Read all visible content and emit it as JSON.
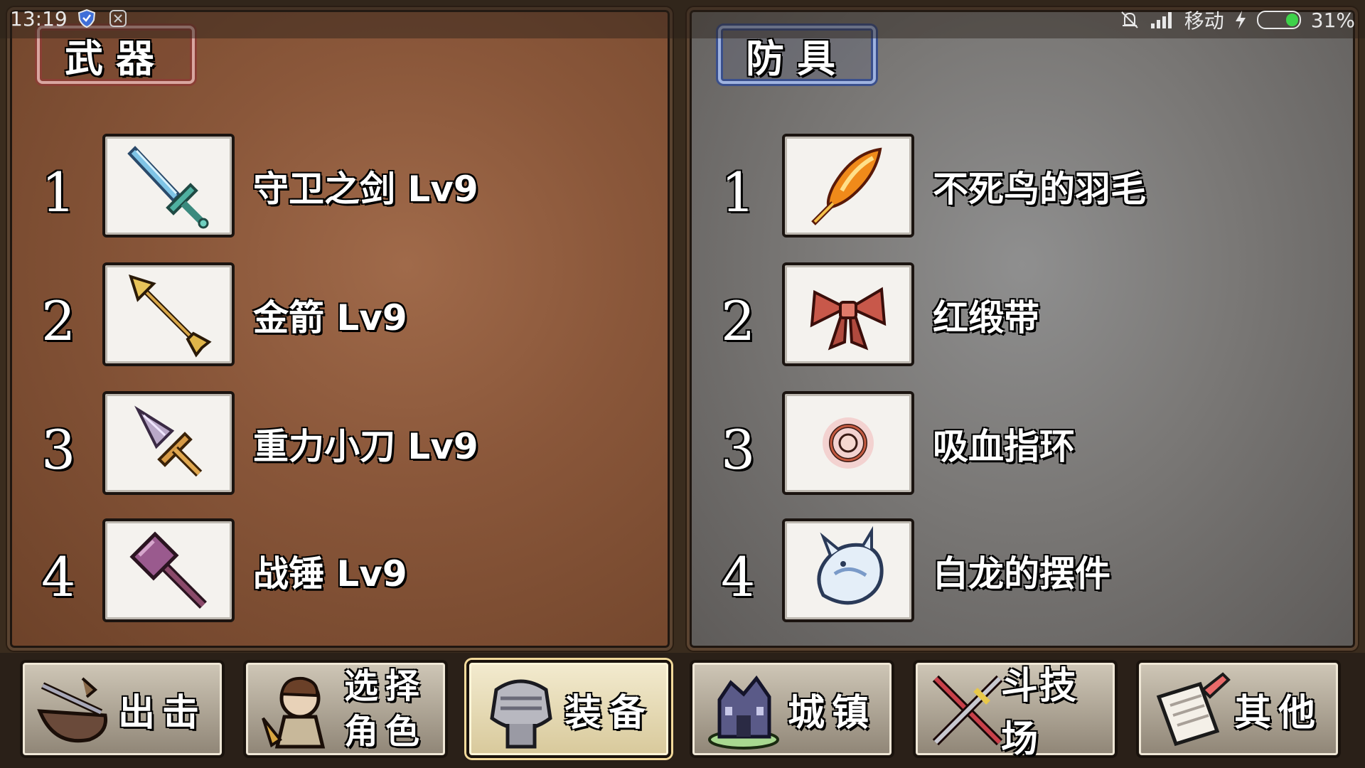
{
  "status_bar": {
    "time": "13:19",
    "carrier": "移动",
    "battery": "31%",
    "battery_level": 0.31
  },
  "weapons": {
    "title": "武器",
    "items": [
      {
        "index": "1",
        "name": "守卫之剑 Lv9",
        "icon": "sword-icon"
      },
      {
        "index": "2",
        "name": "金箭 Lv9",
        "icon": "arrow-icon"
      },
      {
        "index": "3",
        "name": "重力小刀 Lv9",
        "icon": "dagger-icon"
      },
      {
        "index": "4",
        "name": "战锤 Lv9",
        "icon": "hammer-icon"
      }
    ]
  },
  "armor": {
    "title": "防具",
    "items": [
      {
        "index": "1",
        "name": "不死鸟的羽毛",
        "icon": "phoenix-feather-icon"
      },
      {
        "index": "2",
        "name": "红缎带",
        "icon": "red-ribbon-icon"
      },
      {
        "index": "3",
        "name": "吸血指环",
        "icon": "ring-icon"
      },
      {
        "index": "4",
        "name": "白龙的摆件",
        "icon": "white-dragon-icon"
      }
    ]
  },
  "nav": {
    "items": [
      {
        "label": "出击",
        "icon": "sortie-icon"
      },
      {
        "label_line1": "选择",
        "label_line2": "角色",
        "icon": "character-icon"
      },
      {
        "label": "装备",
        "icon": "armor-icon",
        "active": true
      },
      {
        "label": "城镇",
        "icon": "town-icon"
      },
      {
        "label": "斗技场",
        "icon": "arena-icon"
      },
      {
        "label": "其他",
        "icon": "other-icon"
      }
    ]
  },
  "colors": {
    "weapons_panel": "#8a573a",
    "armor_panel": "#7a7876",
    "active_nav": "#f3ebcf"
  }
}
